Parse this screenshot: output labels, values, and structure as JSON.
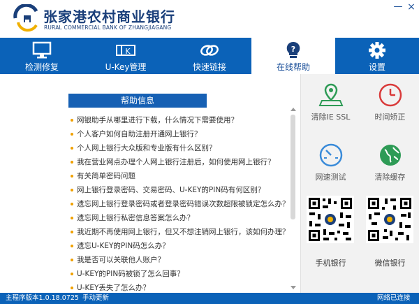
{
  "header": {
    "bank_name_cn": "张家港农村商业银行",
    "bank_name_en": "RURAL COMMERCIAL BANK OF ZHANGJIAGANG",
    "minimize": "—",
    "close": "×"
  },
  "tabs": [
    {
      "label": "检测修复",
      "icon": "monitor-icon"
    },
    {
      "label": "U-Key管理",
      "icon": "ukey-icon"
    },
    {
      "label": "快速链接",
      "icon": "link-icon"
    },
    {
      "label": "在线帮助",
      "icon": "help-bulb-icon",
      "active": true
    },
    {
      "label": "设置",
      "icon": "gear-icon"
    }
  ],
  "help": {
    "title": "帮助信息",
    "items": [
      "网银助手从哪里进行下载，什么情况下需要使用？",
      "个人客户如何自助注册开通网上银行？",
      "个人网上银行大众版和专业版有什么区别？",
      "我在营业网点办理个人网上银行注册后，如何使用网上银行？",
      "有关简单密码问题",
      "网上银行登录密码、交易密码、U-KEY的PIN码有何区别？",
      "遗忘网上银行登录密码或者登录密码错误次数超限被锁定怎么办？",
      "遗忘网上银行私密信息答案怎么办？",
      "我近期不再使用网上银行，但又不想注销网上银行，该如何办理？",
      "遗忘U-KEY的PIN码怎么办？",
      "我是否可以关联他人账户？",
      "U-KEY的PIN码被锁了怎么回事？",
      "U-KEY丢失了怎么办？"
    ]
  },
  "tools": [
    {
      "label": "清除IE SSL",
      "icon": "map-pin-icon",
      "color": "#2e9b56"
    },
    {
      "label": "时间矫正",
      "icon": "clock-icon",
      "color": "#d93a3a"
    },
    {
      "label": "网速测试",
      "icon": "speedometer-icon",
      "color": "#3a8bd9"
    },
    {
      "label": "清除缓存",
      "icon": "globe-icon",
      "color": "#2e9b56"
    }
  ],
  "qr": {
    "mobile_label": "手机银行",
    "wechat_label": "微信银行"
  },
  "status": {
    "version": "主程序版本1.0.18.0725",
    "update": "手动更新",
    "network": "网络已连接"
  },
  "colors": {
    "brand_blue": "#0b62b8",
    "help_title_blue": "#1660b4",
    "bullet": "#f0a000"
  }
}
